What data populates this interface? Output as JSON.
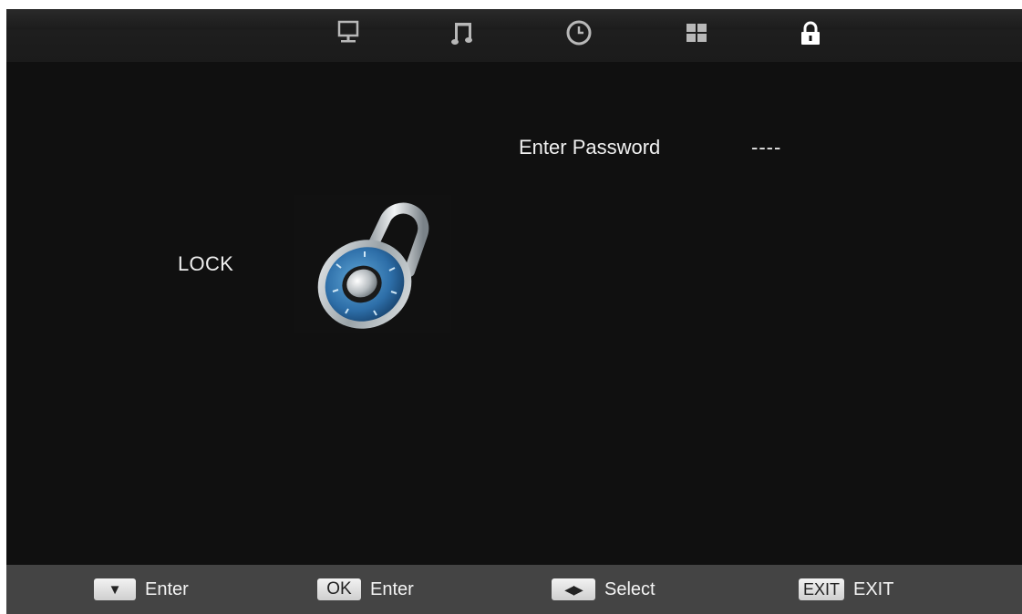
{
  "top_tabs": [
    {
      "name": "picture",
      "icon": "monitor-icon",
      "active": false
    },
    {
      "name": "sound",
      "icon": "music-note-icon",
      "active": false
    },
    {
      "name": "time",
      "icon": "clock-icon",
      "active": false
    },
    {
      "name": "setup",
      "icon": "grid-icon",
      "active": false
    },
    {
      "name": "lock",
      "icon": "padlock-icon",
      "active": true
    }
  ],
  "menu": {
    "title": "LOCK",
    "password_label": "Enter Password",
    "password_value": "----",
    "image": "combination-padlock"
  },
  "colors": {
    "background": "#101010",
    "topbar": "#1c1c1c",
    "bottombar": "#444444",
    "icon_inactive": "#b8b8b8",
    "icon_active": "#ffffff",
    "text": "#f0f0f0"
  },
  "hints": [
    {
      "key": "▼",
      "label": "Enter"
    },
    {
      "key": "OK",
      "label": "Enter"
    },
    {
      "key": "◀▶",
      "label": "Select"
    },
    {
      "key": "EXIT",
      "label": "EXIT"
    }
  ]
}
